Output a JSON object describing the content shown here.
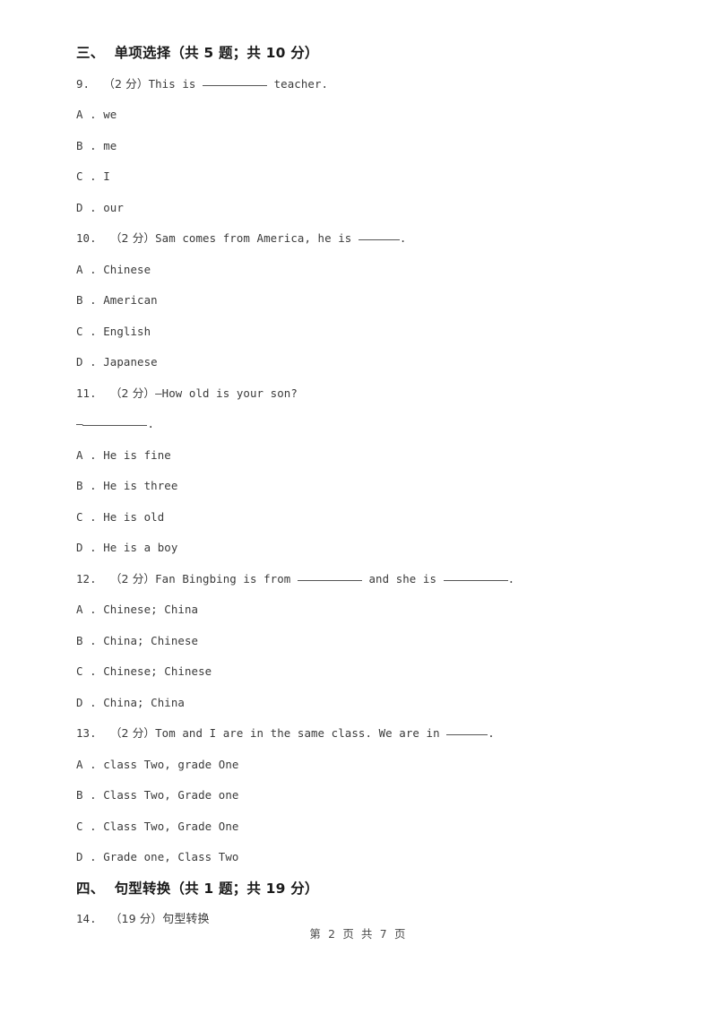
{
  "document": {
    "sections": [
      {
        "heading": "三、  单项选择（共 5 题；共 10 分）",
        "questions": [
          {
            "number": "9.",
            "score": "（2 分）",
            "stem_before": "This is ",
            "blank": "long",
            "stem_after": " teacher.",
            "options": [
              {
                "letter": "A .",
                "text": "we"
              },
              {
                "letter": "B .",
                "text": "me"
              },
              {
                "letter": "C .",
                "text": "I"
              },
              {
                "letter": "D .",
                "text": "our"
              }
            ]
          },
          {
            "number": "10.",
            "score": "（2 分）",
            "stem_before": "Sam comes from America, he is ",
            "blank": "short",
            "stem_after": ".",
            "options": [
              {
                "letter": "A .",
                "text": "Chinese"
              },
              {
                "letter": "B .",
                "text": "American"
              },
              {
                "letter": "C .",
                "text": "English"
              },
              {
                "letter": "D .",
                "text": "Japanese"
              }
            ]
          },
          {
            "number": "11.",
            "score": "（2 分）",
            "stem_before": "—How old is your son?",
            "blank": "none",
            "stem_after": "",
            "answer_line_dash": "—",
            "answer_line_blank": "long",
            "answer_line_after": ".",
            "options": [
              {
                "letter": "A .",
                "text": "He is fine"
              },
              {
                "letter": "B .",
                "text": "He is three"
              },
              {
                "letter": "C .",
                "text": "He is old"
              },
              {
                "letter": "D .",
                "text": "He is a boy"
              }
            ]
          },
          {
            "number": "12.",
            "score": "（2 分）",
            "stem_before": "Fan Bingbing is from ",
            "blank": "long",
            "stem_mid": " and she is ",
            "blank2": "long",
            "stem_after": ".",
            "options": [
              {
                "letter": "A .",
                "text": "Chinese; China"
              },
              {
                "letter": "B .",
                "text": "China; Chinese"
              },
              {
                "letter": "C .",
                "text": "Chinese; Chinese"
              },
              {
                "letter": "D .",
                "text": "China; China"
              }
            ]
          },
          {
            "number": "13.",
            "score": "（2 分）",
            "stem_before": "Tom and I are in the same class. We are in ",
            "blank": "short",
            "stem_after": ".",
            "options": [
              {
                "letter": "A .",
                "text": "class Two, grade One"
              },
              {
                "letter": "B .",
                "text": "Class Two, Grade one"
              },
              {
                "letter": "C .",
                "text": "Class Two, Grade One"
              },
              {
                "letter": "D .",
                "text": "Grade one, Class Two"
              }
            ]
          }
        ]
      },
      {
        "heading": "四、  句型转换（共 1 题；共 19 分）",
        "questions": [
          {
            "number": "14.",
            "score": "（19 分）",
            "stem_before": "句型转换",
            "blank": "none",
            "stem_after": "",
            "options": []
          }
        ]
      }
    ],
    "footer": "第 2 页 共 7 页"
  }
}
